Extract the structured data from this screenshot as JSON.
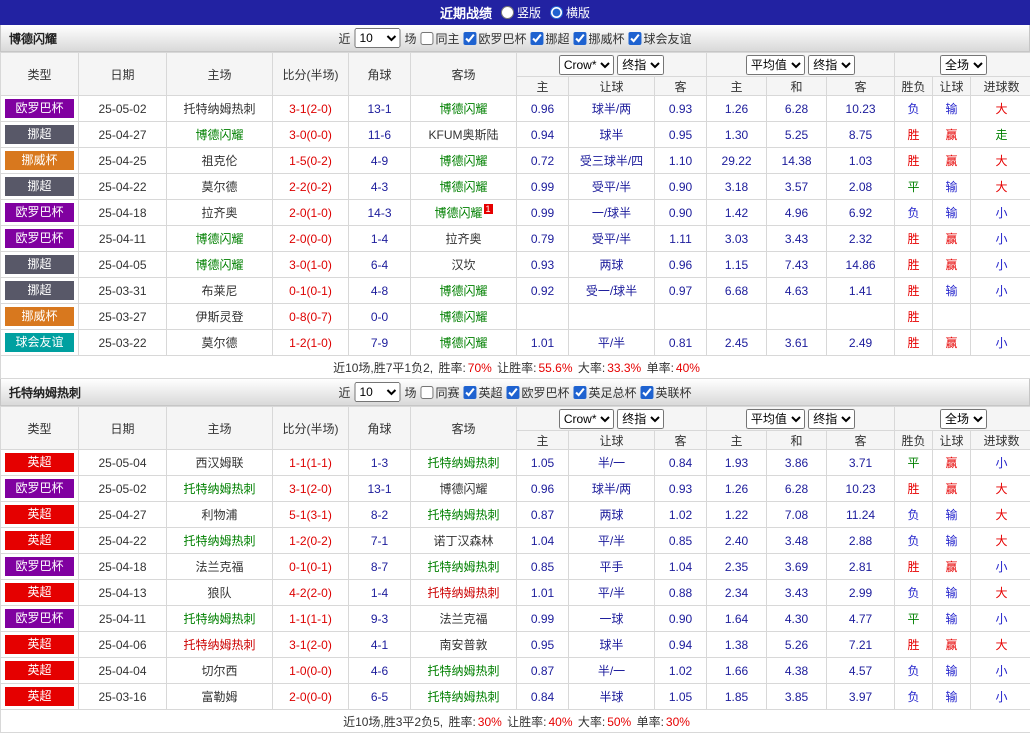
{
  "top_bar": {
    "title": "近期战绩",
    "options": [
      {
        "label": "竖版",
        "selected": false
      },
      {
        "label": "横版",
        "selected": true
      }
    ]
  },
  "labels": {
    "recent": "近",
    "games": "场"
  },
  "table_header": {
    "type": "类型",
    "date": "日期",
    "home": "主场",
    "score": "比分(半场)",
    "corner": "角球",
    "away": "客场",
    "bookmaker_select": "Crow*",
    "final_odds_select": "终指",
    "average_select": "平均值",
    "fulltime_select": "全场",
    "ah_cols": [
      "主",
      "让球",
      "客"
    ],
    "euro_cols": [
      "主",
      "和",
      "客"
    ],
    "result_cols": [
      "胜负",
      "让球",
      "进球数"
    ]
  },
  "colors": {
    "top_bar_bg": "#2222a2",
    "red": "#e60000",
    "green": "#008000",
    "blue": "#2424cc",
    "score": "#dd0000",
    "odds": "#1b1b9b",
    "team_green": "#008000",
    "team_red": "#cc0000",
    "result_map": {
      "胜": "#e60000",
      "赢": "#e60000",
      "大": "#e60000",
      "平": "#008000",
      "走": "#008000",
      "负": "#2424cc",
      "输": "#2424cc",
      "小": "#2424cc"
    }
  },
  "league_colors": {
    "欧罗巴杯": "#8000a0",
    "挪超": "#585868",
    "挪威杯": "#d8781e",
    "球会友谊": "#00a0a0",
    "英超": "#e50000"
  },
  "sections": [
    {
      "team": "博德闪耀",
      "filter": {
        "count": "10",
        "same_label": "同主",
        "same_checked": false,
        "leagues": [
          {
            "label": "欧罗巴杯",
            "checked": true
          },
          {
            "label": "挪超",
            "checked": true
          },
          {
            "label": "挪威杯",
            "checked": true
          },
          {
            "label": "球会友谊",
            "checked": true
          }
        ]
      },
      "rows": [
        {
          "league": "欧罗巴杯",
          "date": "25-05-02",
          "home": "托特纳姆热刺",
          "home_hl": "",
          "score": "3-1(2-0)",
          "corner": "13-1",
          "away": "博德闪耀",
          "away_hl": "green",
          "ah_home": "0.96",
          "ah_line": "球半/两",
          "ah_away": "0.93",
          "eu_home": "1.26",
          "eu_draw": "6.28",
          "eu_away": "10.23",
          "res_wdl": "负",
          "res_ah": "输",
          "res_ou": "大"
        },
        {
          "league": "挪超",
          "date": "25-04-27",
          "home": "博德闪耀",
          "home_hl": "green",
          "score": "3-0(0-0)",
          "corner": "11-6",
          "away": "KFUM奥斯陆",
          "away_hl": "",
          "ah_home": "0.94",
          "ah_line": "球半",
          "ah_away": "0.95",
          "eu_home": "1.30",
          "eu_draw": "5.25",
          "eu_away": "8.75",
          "res_wdl": "胜",
          "res_ah": "赢",
          "res_ou": "走"
        },
        {
          "league": "挪威杯",
          "date": "25-04-25",
          "home": "祖克伦",
          "home_hl": "",
          "score": "1-5(0-2)",
          "corner": "4-9",
          "away": "博德闪耀",
          "away_hl": "green",
          "ah_home": "0.72",
          "ah_line": "受三球半/四",
          "ah_away": "1.10",
          "eu_home": "29.22",
          "eu_draw": "14.38",
          "eu_away": "1.03",
          "res_wdl": "胜",
          "res_ah": "赢",
          "res_ou": "大"
        },
        {
          "league": "挪超",
          "date": "25-04-22",
          "home": "莫尔德",
          "home_hl": "",
          "score": "2-2(0-2)",
          "corner": "4-3",
          "away": "博德闪耀",
          "away_hl": "green",
          "ah_home": "0.99",
          "ah_line": "受平/半",
          "ah_away": "0.90",
          "eu_home": "3.18",
          "eu_draw": "3.57",
          "eu_away": "2.08",
          "res_wdl": "平",
          "res_ah": "输",
          "res_ou": "大"
        },
        {
          "league": "欧罗巴杯",
          "date": "25-04-18",
          "home": "拉齐奥",
          "home_hl": "",
          "score": "2-0(1-0)",
          "corner": "14-3",
          "away": "博德闪耀",
          "away_hl": "green",
          "away_badge": "1",
          "ah_home": "0.99",
          "ah_line": "一/球半",
          "ah_away": "0.90",
          "eu_home": "1.42",
          "eu_draw": "4.96",
          "eu_away": "6.92",
          "res_wdl": "负",
          "res_ah": "输",
          "res_ou": "小"
        },
        {
          "league": "欧罗巴杯",
          "date": "25-04-11",
          "home": "博德闪耀",
          "home_hl": "green",
          "score": "2-0(0-0)",
          "corner": "1-4",
          "away": "拉齐奥",
          "away_hl": "",
          "ah_home": "0.79",
          "ah_line": "受平/半",
          "ah_away": "1.11",
          "eu_home": "3.03",
          "eu_draw": "3.43",
          "eu_away": "2.32",
          "res_wdl": "胜",
          "res_ah": "赢",
          "res_ou": "小"
        },
        {
          "league": "挪超",
          "date": "25-04-05",
          "home": "博德闪耀",
          "home_hl": "green",
          "score": "3-0(1-0)",
          "corner": "6-4",
          "away": "汉坎",
          "away_hl": "",
          "ah_home": "0.93",
          "ah_line": "两球",
          "ah_away": "0.96",
          "eu_home": "1.15",
          "eu_draw": "7.43",
          "eu_away": "14.86",
          "res_wdl": "胜",
          "res_ah": "赢",
          "res_ou": "小"
        },
        {
          "league": "挪超",
          "date": "25-03-31",
          "home": "布莱尼",
          "home_hl": "",
          "score": "0-1(0-1)",
          "corner": "4-8",
          "away": "博德闪耀",
          "away_hl": "green",
          "ah_home": "0.92",
          "ah_line": "受一/球半",
          "ah_away": "0.97",
          "eu_home": "6.68",
          "eu_draw": "4.63",
          "eu_away": "1.41",
          "res_wdl": "胜",
          "res_ah": "输",
          "res_ou": "小"
        },
        {
          "league": "挪威杯",
          "date": "25-03-27",
          "home": "伊斯灵登",
          "home_hl": "",
          "score": "0-8(0-7)",
          "corner": "0-0",
          "away": "博德闪耀",
          "away_hl": "green",
          "ah_home": "",
          "ah_line": "",
          "ah_away": "",
          "eu_home": "",
          "eu_draw": "",
          "eu_away": "",
          "res_wdl": "胜",
          "res_ah": "",
          "res_ou": ""
        },
        {
          "league": "球会友谊",
          "date": "25-03-22",
          "home": "莫尔德",
          "home_hl": "",
          "score": "1-2(1-0)",
          "corner": "7-9",
          "away": "博德闪耀",
          "away_hl": "green",
          "ah_home": "1.01",
          "ah_line": "平/半",
          "ah_away": "0.81",
          "eu_home": "2.45",
          "eu_draw": "3.61",
          "eu_away": "2.49",
          "res_wdl": "胜",
          "res_ah": "赢",
          "res_ou": "小"
        }
      ],
      "summary": [
        {
          "text": "近10场,胜7平1负2, ",
          "red": false
        },
        {
          "text": "胜率:",
          "red": false
        },
        {
          "text": "70%",
          "red": true
        },
        {
          "text": " 让胜率:",
          "red": false
        },
        {
          "text": "55.6%",
          "red": true
        },
        {
          "text": " 大率:",
          "red": false
        },
        {
          "text": "33.3%",
          "red": true
        },
        {
          "text": " 单率:",
          "red": false
        },
        {
          "text": "40%",
          "red": true
        }
      ]
    },
    {
      "team": "托特纳姆热刺",
      "filter": {
        "count": "10",
        "same_label": "同赛",
        "same_checked": false,
        "leagues": [
          {
            "label": "英超",
            "checked": true
          },
          {
            "label": "欧罗巴杯",
            "checked": true
          },
          {
            "label": "英足总杯",
            "checked": true
          },
          {
            "label": "英联杯",
            "checked": true
          }
        ]
      },
      "rows": [
        {
          "league": "英超",
          "date": "25-05-04",
          "home": "西汉姆联",
          "home_hl": "",
          "score": "1-1(1-1)",
          "corner": "1-3",
          "away": "托特纳姆热刺",
          "away_hl": "green",
          "ah_home": "1.05",
          "ah_line": "半/一",
          "ah_away": "0.84",
          "eu_home": "1.93",
          "eu_draw": "3.86",
          "eu_away": "3.71",
          "res_wdl": "平",
          "res_ah": "赢",
          "res_ou": "小"
        },
        {
          "league": "欧罗巴杯",
          "date": "25-05-02",
          "home": "托特纳姆热刺",
          "home_hl": "green",
          "score": "3-1(2-0)",
          "corner": "13-1",
          "away": "博德闪耀",
          "away_hl": "",
          "ah_home": "0.96",
          "ah_line": "球半/两",
          "ah_away": "0.93",
          "eu_home": "1.26",
          "eu_draw": "6.28",
          "eu_away": "10.23",
          "res_wdl": "胜",
          "res_ah": "赢",
          "res_ou": "大"
        },
        {
          "league": "英超",
          "date": "25-04-27",
          "home": "利物浦",
          "home_hl": "",
          "score": "5-1(3-1)",
          "corner": "8-2",
          "away": "托特纳姆热刺",
          "away_hl": "green",
          "ah_home": "0.87",
          "ah_line": "两球",
          "ah_away": "1.02",
          "eu_home": "1.22",
          "eu_draw": "7.08",
          "eu_away": "11.24",
          "res_wdl": "负",
          "res_ah": "输",
          "res_ou": "大"
        },
        {
          "league": "英超",
          "date": "25-04-22",
          "home": "托特纳姆热刺",
          "home_hl": "green",
          "score": "1-2(0-2)",
          "corner": "7-1",
          "away": "诺丁汉森林",
          "away_hl": "",
          "ah_home": "1.04",
          "ah_line": "平/半",
          "ah_away": "0.85",
          "eu_home": "2.40",
          "eu_draw": "3.48",
          "eu_away": "2.88",
          "res_wdl": "负",
          "res_ah": "输",
          "res_ou": "大"
        },
        {
          "league": "欧罗巴杯",
          "date": "25-04-18",
          "home": "法兰克福",
          "home_hl": "",
          "score": "0-1(0-1)",
          "corner": "8-7",
          "away": "托特纳姆热刺",
          "away_hl": "green",
          "ah_home": "0.85",
          "ah_line": "平手",
          "ah_away": "1.04",
          "eu_home": "2.35",
          "eu_draw": "3.69",
          "eu_away": "2.81",
          "res_wdl": "胜",
          "res_ah": "赢",
          "res_ou": "小"
        },
        {
          "league": "英超",
          "date": "25-04-13",
          "home": "狼队",
          "home_hl": "",
          "score": "4-2(2-0)",
          "corner": "1-4",
          "away": "托特纳姆热刺",
          "away_hl": "red",
          "ah_home": "1.01",
          "ah_line": "平/半",
          "ah_away": "0.88",
          "eu_home": "2.34",
          "eu_draw": "3.43",
          "eu_away": "2.99",
          "res_wdl": "负",
          "res_ah": "输",
          "res_ou": "大"
        },
        {
          "league": "欧罗巴杯",
          "date": "25-04-11",
          "home": "托特纳姆热刺",
          "home_hl": "green",
          "score": "1-1(1-1)",
          "corner": "9-3",
          "away": "法兰克福",
          "away_hl": "",
          "ah_home": "0.99",
          "ah_line": "一球",
          "ah_away": "0.90",
          "eu_home": "1.64",
          "eu_draw": "4.30",
          "eu_away": "4.77",
          "res_wdl": "平",
          "res_ah": "输",
          "res_ou": "小"
        },
        {
          "league": "英超",
          "date": "25-04-06",
          "home": "托特纳姆热刺",
          "home_hl": "red",
          "score": "3-1(2-0)",
          "corner": "4-1",
          "away": "南安普敦",
          "away_hl": "",
          "ah_home": "0.95",
          "ah_line": "球半",
          "ah_away": "0.94",
          "eu_home": "1.38",
          "eu_draw": "5.26",
          "eu_away": "7.21",
          "res_wdl": "胜",
          "res_ah": "赢",
          "res_ou": "大"
        },
        {
          "league": "英超",
          "date": "25-04-04",
          "home": "切尔西",
          "home_hl": "",
          "score": "1-0(0-0)",
          "corner": "4-6",
          "away": "托特纳姆热刺",
          "away_hl": "green",
          "ah_home": "0.87",
          "ah_line": "半/一",
          "ah_away": "1.02",
          "eu_home": "1.66",
          "eu_draw": "4.38",
          "eu_away": "4.57",
          "res_wdl": "负",
          "res_ah": "输",
          "res_ou": "小"
        },
        {
          "league": "英超",
          "date": "25-03-16",
          "home": "富勒姆",
          "home_hl": "",
          "score": "2-0(0-0)",
          "corner": "6-5",
          "away": "托特纳姆热刺",
          "away_hl": "green",
          "ah_home": "0.84",
          "ah_line": "半球",
          "ah_away": "1.05",
          "eu_home": "1.85",
          "eu_draw": "3.85",
          "eu_away": "3.97",
          "res_wdl": "负",
          "res_ah": "输",
          "res_ou": "小"
        }
      ],
      "summary": [
        {
          "text": "近10场,胜3平2负5, ",
          "red": false
        },
        {
          "text": "胜率:",
          "red": false
        },
        {
          "text": "30%",
          "red": true
        },
        {
          "text": " 让胜率:",
          "red": false
        },
        {
          "text": "40%",
          "red": true
        },
        {
          "text": " 大率:",
          "red": false
        },
        {
          "text": "50%",
          "red": true
        },
        {
          "text": " 单率:",
          "red": false
        },
        {
          "text": "30%",
          "red": true
        }
      ]
    }
  ]
}
